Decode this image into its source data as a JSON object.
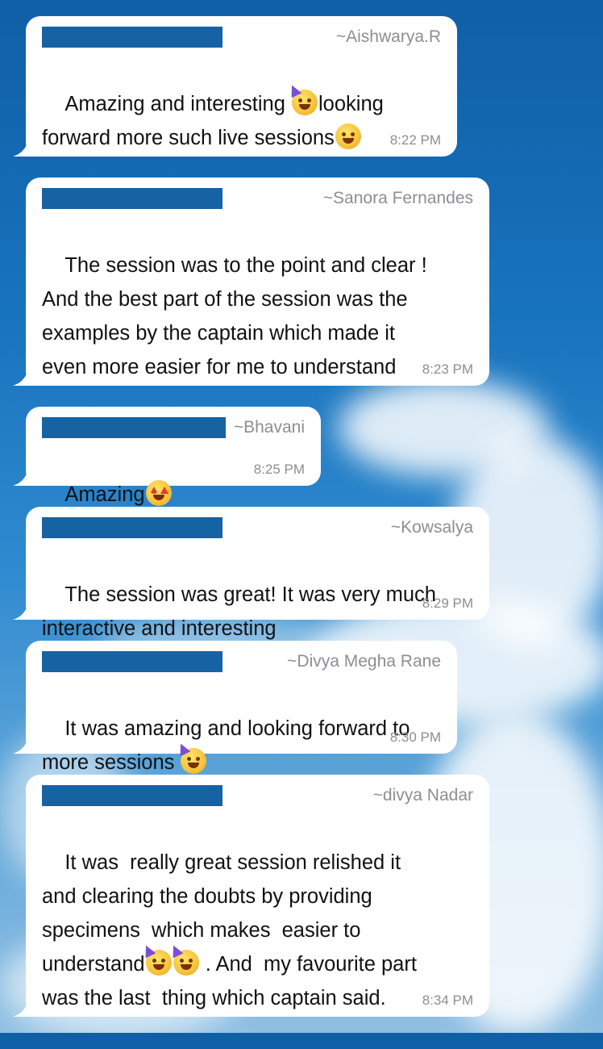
{
  "messages": [
    {
      "sender": "~Aishwarya.R",
      "segments": [
        "Amazing and interesting ",
        "looking",
        "forward more such live sessions",
        ""
      ],
      "time": "8:22 PM",
      "icons": [
        "partying-face-icon",
        "grinning-face-icon"
      ]
    },
    {
      "sender": "~Sanora Fernandes",
      "lines": [
        "The session was to the point and clear !",
        "And the best part of the session was the",
        "examples by the captain which made it",
        "even more easier for me to understand"
      ],
      "time": "8:23 PM"
    },
    {
      "sender": "~Bhavani",
      "text": "Amazing",
      "time": "8:25 PM",
      "icons": [
        "star-struck-icon"
      ]
    },
    {
      "sender": "~Kowsalya",
      "lines": [
        "The session was great! It was very much",
        "interactive and interesting"
      ],
      "time": "8:29 PM"
    },
    {
      "sender": "~Divya Megha Rane",
      "lines": [
        "It was amazing and looking forward to",
        "more sessions "
      ],
      "time": "8:30 PM",
      "icons": [
        "partying-face-icon"
      ]
    },
    {
      "sender": "~divya Nadar",
      "lines": [
        "It was  really great session relished it",
        "and clearing the doubts by providing",
        "specimens  which makes  easier to",
        "understand",
        " . And  my favourite part",
        "was the last  thing which captain said."
      ],
      "time": "8:34 PM",
      "icons": [
        "partying-face-icon",
        "partying-face-icon"
      ]
    }
  ],
  "colors": {
    "bubble": "#ffffff",
    "redaction": "#1663a4",
    "meta_text": "#8e8e93",
    "body_text": "#111111"
  }
}
